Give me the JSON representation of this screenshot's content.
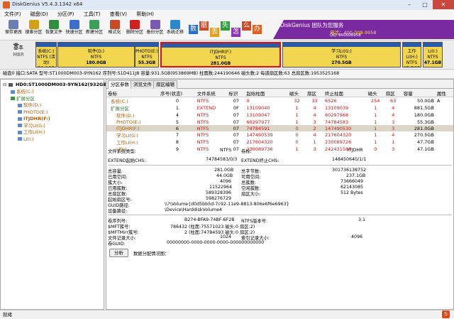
{
  "window": {
    "title": "DiskGenius V5.4.3.1342 x64"
  },
  "menu": [
    "文件(F)",
    "磁盘(D)",
    "分区(P)",
    "工具(T)",
    "查看(V)",
    "帮助(H)"
  ],
  "toolbar": [
    {
      "label": "保存更改",
      "icon": "save-icon",
      "color": "#6a7fb0"
    },
    {
      "label": "搜索分区",
      "icon": "search-partition-icon",
      "color": "#d4a017"
    },
    {
      "label": "恢复文件",
      "icon": "recover-file-icon",
      "color": "#2f8f3a"
    },
    {
      "label": "快速分区",
      "icon": "quick-partition-icon",
      "color": "#3b6fc8"
    },
    {
      "label": "新建分区",
      "icon": "new-partition-icon",
      "color": "#3aa05a"
    },
    {
      "label": "格式化",
      "icon": "format-icon",
      "color": "#c84a2a"
    },
    {
      "label": "删除分区",
      "icon": "delete-partition-icon",
      "color": "#d02020"
    },
    {
      "label": "备份分区",
      "icon": "backup-partition-icon",
      "color": "#7a5ab0"
    },
    {
      "label": "系统迁移",
      "icon": "system-migration-icon",
      "color": "#2c88c8"
    }
  ],
  "banner": {
    "chars": [
      "数",
      "据",
      "丢",
      "失",
      "怎",
      "么",
      "办"
    ],
    "brand": "DiskGenius 团队为您服务",
    "phone": "电话：400-008-9958",
    "qq": "QQ: 800008958"
  },
  "disk_map": {
    "disk_label": "基本",
    "disk_type": "MBR",
    "partitions": [
      {
        "name": "系统(C:)",
        "fs": "NTFS (活动)",
        "size": "50.0GB",
        "color": "#f2d650",
        "selected": false
      },
      {
        "name": "软件(D:)",
        "fs": "NTFS",
        "size": "180.0GB",
        "color": "#f2d650",
        "selected": false
      },
      {
        "name": "PHOTO(E:)",
        "fs": "NTFS",
        "size": "55.3GB",
        "color": "#f2d650",
        "selected": false
      },
      {
        "name": "ITJDHR(F:)",
        "fs": "NTFS",
        "size": "281.0GB",
        "color": "#f2d650",
        "selected": true
      },
      {
        "name": "学习LI(G:)",
        "fs": "NTFS",
        "size": "270.5GB",
        "color": "#f2d650",
        "selected": false
      },
      {
        "name": "工作LI(H:)",
        "fs": "NTFS",
        "size": "47.7GB",
        "color": "#f2d650",
        "selected": false
      },
      {
        "name": "LI(I:)",
        "fs": "NTFS",
        "size": "47.1GB",
        "color": "#f2d650",
        "selected": false
      }
    ]
  },
  "info_bar": "磁盘0 接口:SATA  型号:ST1000DM003-9YN162  序列号:S1D411J8  容量:931.5GB(953869MB)  柱面数:244190646  磁头数:2  每道扇区数:63  总扇区数:1953525168",
  "tree": {
    "disk": "HD0:ST1000DM003-9YN162(932GB)",
    "items": [
      {
        "label": "系统(C:)",
        "level": 1
      },
      {
        "label": "扩展分区",
        "level": 1
      },
      {
        "label": "软件(D:)",
        "level": 2
      },
      {
        "label": "PHOTO(E:)",
        "level": 2
      },
      {
        "label": "ITJDHR(F:)",
        "level": 2
      },
      {
        "label": "学习LI(G:)",
        "level": 2
      },
      {
        "label": "工作LI(H:)",
        "level": 2
      },
      {
        "label": "LI(I:)",
        "level": 2
      }
    ]
  },
  "tabs": [
    "分区参数",
    "浏览文件",
    "扇区编辑"
  ],
  "table": {
    "headers": [
      "卷标",
      "序号(状态)",
      "文件系统",
      "标识",
      "起始柱面",
      "磁头",
      "扇区",
      "终止柱面",
      "磁头",
      "扇区",
      "容量",
      "属性"
    ],
    "rows": [
      [
        "系统(C:)",
        "0",
        "NTFS",
        "07",
        "0",
        "32",
        "33",
        "6526",
        "254",
        "63",
        "50.0GB",
        "A"
      ],
      [
        "扩展分区",
        "1",
        "EXTEND",
        "0F",
        "13109040",
        "1",
        "4",
        "13109039",
        "1",
        "4",
        "881.5GB",
        ""
      ],
      [
        "软件(D:)",
        "4",
        "NTFS",
        "07",
        "13109047",
        "1",
        "4",
        "60297968",
        "1",
        "4",
        "180.0GB",
        ""
      ],
      [
        "PHOTO(E:)",
        "5",
        "NTFS",
        "07",
        "60297977",
        "1",
        "3",
        "74784583",
        "1",
        "3",
        "55.3GB",
        ""
      ],
      [
        "ITJDHR(F:)",
        "6",
        "NTFS",
        "07",
        "74784591",
        "0",
        "2",
        "147490530",
        "1",
        "3",
        "281.0GB",
        ""
      ],
      [
        "学习LI(G:)",
        "7",
        "NTFS",
        "07",
        "147490539",
        "0",
        "4",
        "217604320",
        "1",
        "4",
        "270.5GB",
        ""
      ],
      [
        "工作LI(H:)",
        "8",
        "NTFS",
        "07",
        "217604320",
        "0",
        "1",
        "230089726",
        "1",
        "1",
        "47.7GB",
        ""
      ],
      [
        "LI(I:)",
        "9",
        "NTFS",
        "07",
        "230089736",
        "1",
        "3",
        "242431584",
        "0",
        "3",
        "47.1GB",
        ""
      ]
    ]
  },
  "details": {
    "fs_type_label": "文件系统类型:",
    "fs_type": "NTFS",
    "vol_label_label": "卷标:",
    "vol_label": "ITJDHR",
    "ext_start_label": "EXTEND起始CHS:",
    "ext_start": "74784583/0/3",
    "ext_end_label": "EXTEND终止CHS:",
    "ext_end": "148450640/1/1",
    "total_label": "总容量:",
    "total": "281.0GB",
    "total_bytes_label": "总字节数:",
    "total_bytes": "301736138752",
    "used_label": "已用空间:",
    "used": "44.0GB",
    "free_label": "可用空间:",
    "free": "237.1GB",
    "cluster_label": "簇大小:",
    "cluster": "4096",
    "total_clusters_label": "总簇数:",
    "total_clusters": "73666049",
    "used_clusters_label": "已用簇数:",
    "used_clusters": "11522964",
    "free_clusters_label": "空闲簇数:",
    "free_clusters": "62143085",
    "total_sectors_label": "总扇区数:",
    "total_sectors": "589328396",
    "sector_size_label": "扇区大小:",
    "sector_size": "512 Bytes",
    "start_sector_label": "起始扇区号:",
    "start_sector": "598276729",
    "guid_path_label": "GUID路径:",
    "guid_path": "\\\\?\\Volume{d0d5bb5d-7c92-11e9-8813-806e6f6e6963}",
    "device_path_label": "设备路径:",
    "device_path": "\\Device\\HarddiskVolume4",
    "serial_label": "卷序列号:",
    "serial": "B274-BFA9-74BF-6F2B",
    "ntfs_ver_label": "NTFS版本号:",
    "ntfs_ver": "3.1",
    "mft_label": "$MFT簇号:",
    "mft": "786432 (柱面:75571023 磁头:0 扇区:2)",
    "mftmirr_label": "$MFTMirr簇号:",
    "mftmirr": "2 (柱面:74784593 磁头:0 扇区:2)",
    "record_label": "文件记录大小:",
    "record": "1024",
    "index_label": "索引记录大小:",
    "index": "4096",
    "vol_guid_label": "卷GUID:",
    "vol_guid": "00000000-0000-0000-0000-000000000000",
    "analyze_button": "分析",
    "alloc_label": "数据分配情况图："
  },
  "status": {
    "text": "就绪",
    "right": "S"
  }
}
